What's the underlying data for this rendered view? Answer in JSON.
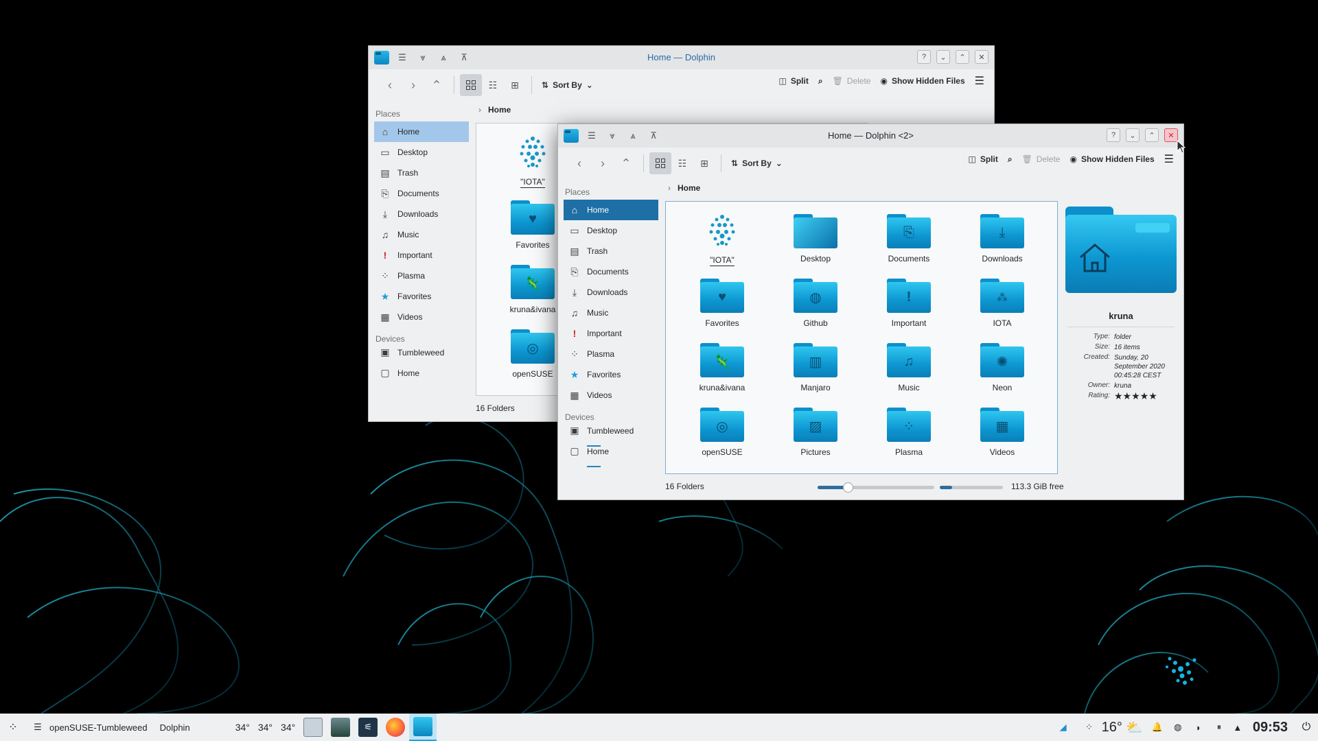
{
  "colors": {
    "accent": "#1aa2e0",
    "selection": "#1e6fa5",
    "folder": "#0d96d1",
    "close_hot": "#e1505e"
  },
  "window_back": {
    "title": "Home — Dolphin",
    "toolbar": {
      "sort_label": "Sort By",
      "split_label": "Split",
      "delete_label": "Delete",
      "hidden_label": "Show Hidden Files"
    },
    "breadcrumb": "Home",
    "places_header": "Places",
    "devices_header": "Devices",
    "places": [
      {
        "label": "Home",
        "icon": "home-icon"
      },
      {
        "label": "Desktop",
        "icon": "desktop-icon"
      },
      {
        "label": "Trash",
        "icon": "trash-icon"
      },
      {
        "label": "Documents",
        "icon": "documents-icon"
      },
      {
        "label": "Downloads",
        "icon": "downloads-icon"
      },
      {
        "label": "Music",
        "icon": "music-icon"
      },
      {
        "label": "Important",
        "icon": "important-icon"
      },
      {
        "label": "Plasma",
        "icon": "plasma-icon"
      },
      {
        "label": "Favorites",
        "icon": "star-icon"
      },
      {
        "label": "Videos",
        "icon": "videos-icon"
      }
    ],
    "devices": [
      {
        "label": "Tumbleweed",
        "usage": 0.0
      },
      {
        "label": "Home",
        "usage": 0.0
      }
    ],
    "visible_items": [
      "\"IOTA\"",
      "Favorites",
      "kruna&ivana",
      "openSUSE"
    ],
    "status": "16 Folders"
  },
  "window_front": {
    "title": "Home — Dolphin <2>",
    "toolbar": {
      "sort_label": "Sort By",
      "split_label": "Split",
      "delete_label": "Delete",
      "hidden_label": "Show Hidden Files"
    },
    "breadcrumb": "Home",
    "places_header": "Places",
    "devices_header": "Devices",
    "places": [
      {
        "label": "Home"
      },
      {
        "label": "Desktop"
      },
      {
        "label": "Trash"
      },
      {
        "label": "Documents"
      },
      {
        "label": "Downloads"
      },
      {
        "label": "Music"
      },
      {
        "label": "Important"
      },
      {
        "label": "Plasma"
      },
      {
        "label": "Favorites"
      },
      {
        "label": "Videos"
      }
    ],
    "devices": [
      {
        "label": "Tumbleweed"
      },
      {
        "label": "Home"
      }
    ],
    "items": [
      {
        "name": "\"IOTA\"",
        "icon": "iota-logo-icon"
      },
      {
        "name": "Desktop",
        "icon": "desktop-folder-icon"
      },
      {
        "name": "Documents",
        "icon": "documents-folder-icon"
      },
      {
        "name": "Downloads",
        "icon": "downloads-folder-icon"
      },
      {
        "name": "Favorites",
        "icon": "favorites-folder-icon"
      },
      {
        "name": "Github",
        "icon": "github-folder-icon"
      },
      {
        "name": "Important",
        "icon": "important-folder-icon"
      },
      {
        "name": "IOTA",
        "icon": "iota-folder-icon"
      },
      {
        "name": "kruna&ivana",
        "icon": "chameleon-folder-icon"
      },
      {
        "name": "Manjaro",
        "icon": "manjaro-folder-icon"
      },
      {
        "name": "Music",
        "icon": "music-folder-icon"
      },
      {
        "name": "Neon",
        "icon": "neon-folder-icon"
      },
      {
        "name": "openSUSE",
        "icon": "opensuse-folder-icon"
      },
      {
        "name": "Pictures",
        "icon": "pictures-folder-icon"
      },
      {
        "name": "Plasma",
        "icon": "plasma-folder-icon"
      },
      {
        "name": "Videos",
        "icon": "videos-folder-icon"
      }
    ],
    "status": "16 Folders",
    "zoom_level": 0.26,
    "space_used": 0.2,
    "free_space": "113.3 GiB free",
    "info": {
      "name": "kruna",
      "type_key": "Type:",
      "type": "folder",
      "size_key": "Size:",
      "size": "16 items",
      "created_key": "Created:",
      "created": "Sunday, 20 September 2020 00:45:28 CEST",
      "owner_key": "Owner:",
      "owner": "kruna",
      "rating_key": "Rating:",
      "rating": "★★★★★"
    }
  },
  "taskbar": {
    "distro": "openSUSE-Tumbleweed",
    "app": "Dolphin",
    "temps": [
      "34°",
      "34°",
      "34°"
    ],
    "weather_temp": "16°",
    "clock": "09:53"
  }
}
